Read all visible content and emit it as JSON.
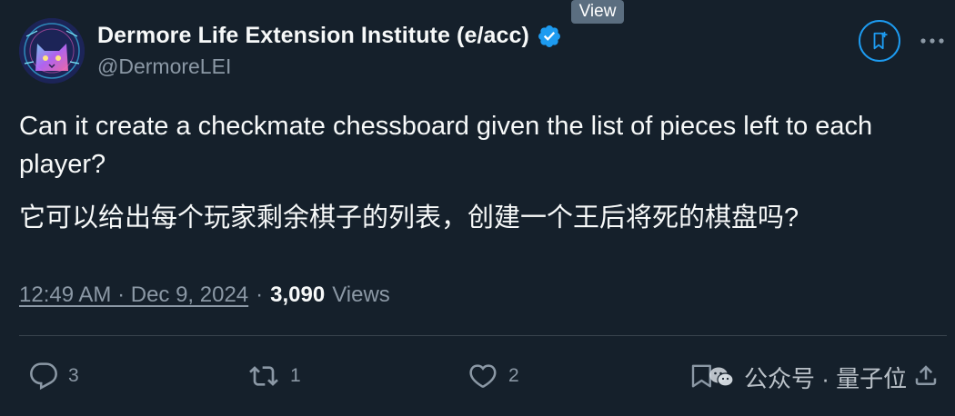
{
  "tooltip": {
    "text": "View"
  },
  "author": {
    "display_name": "Dermore Life Extension Institute (e/acc)",
    "handle": "@DermoreLEI",
    "verified": true,
    "avatar_icon": "cat-avatar"
  },
  "tweet": {
    "text_en": "Can it create a checkmate chessboard given the list of pieces left to each player?",
    "text_zh": "它可以给出每个玩家剩余棋子的列表，创建一个王后将死的棋盘吗?"
  },
  "meta": {
    "timestamp": "12:49 AM · Dec 9, 2024",
    "separator": "·",
    "views_count": "3,090",
    "views_label": "Views"
  },
  "actions": {
    "reply_count": "3",
    "repost_count": "1",
    "like_count": "2"
  },
  "watermark": {
    "text": "公众号 · 量子位"
  },
  "colors": {
    "background": "#15202b",
    "text_primary": "#f7f9f9",
    "text_secondary": "#8b98a5",
    "accent": "#1d9bf0",
    "divider": "#38444d"
  }
}
